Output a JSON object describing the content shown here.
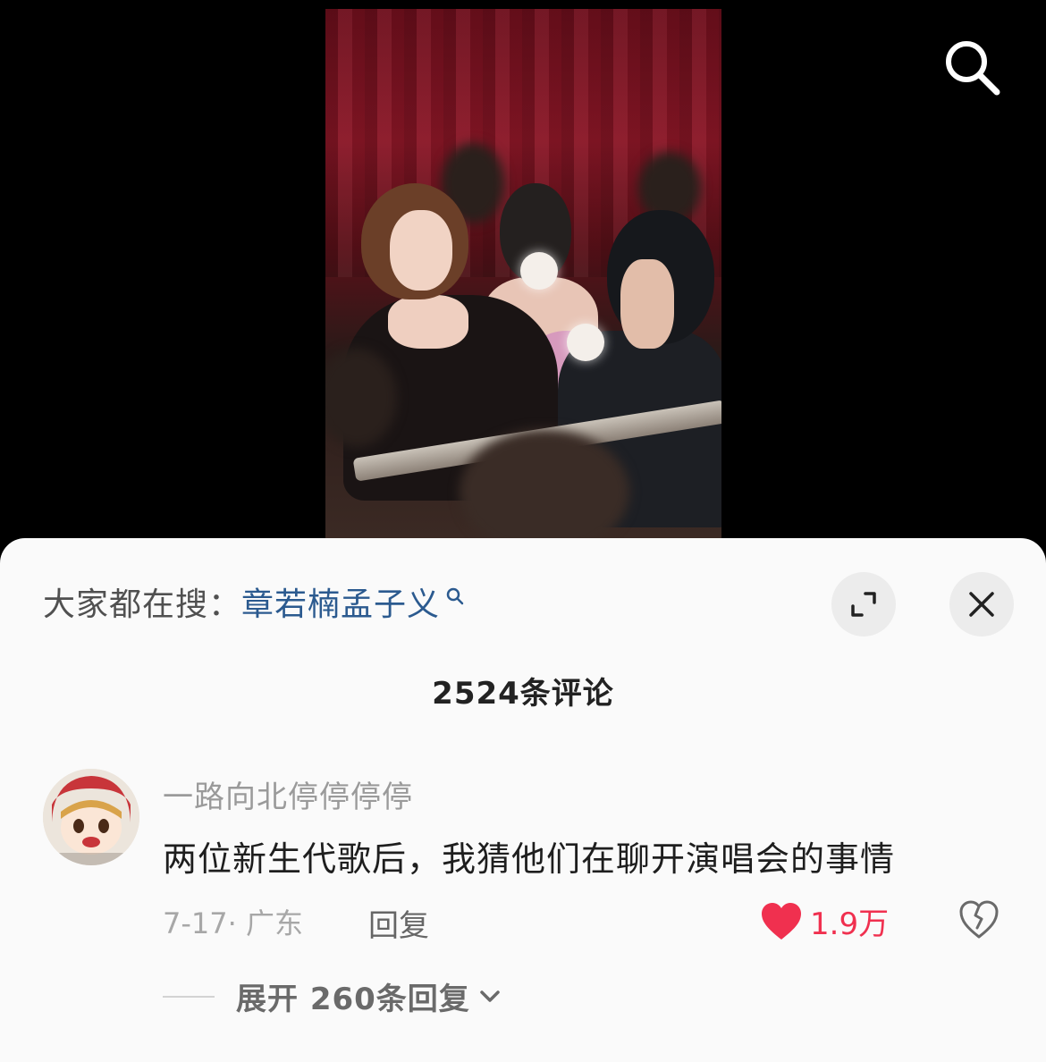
{
  "search": {
    "icon": "search-icon"
  },
  "hot_search": {
    "label": "大家都在搜：",
    "term": "章若楠孟子义"
  },
  "header": {
    "comment_count": "2524条评论"
  },
  "comment": {
    "username": "一路向北停停停停",
    "text": "两位新生代歌后，我猜他们在聊开演唱会的事情",
    "date_location": "7-17· 广东",
    "reply_label": "回复",
    "like_count": "1.9万",
    "expand_label": "展开 260条回复"
  },
  "colors": {
    "hot_term": "#2b5a8f",
    "like": "#f0304f",
    "sheet_bg": "#fafafa"
  }
}
